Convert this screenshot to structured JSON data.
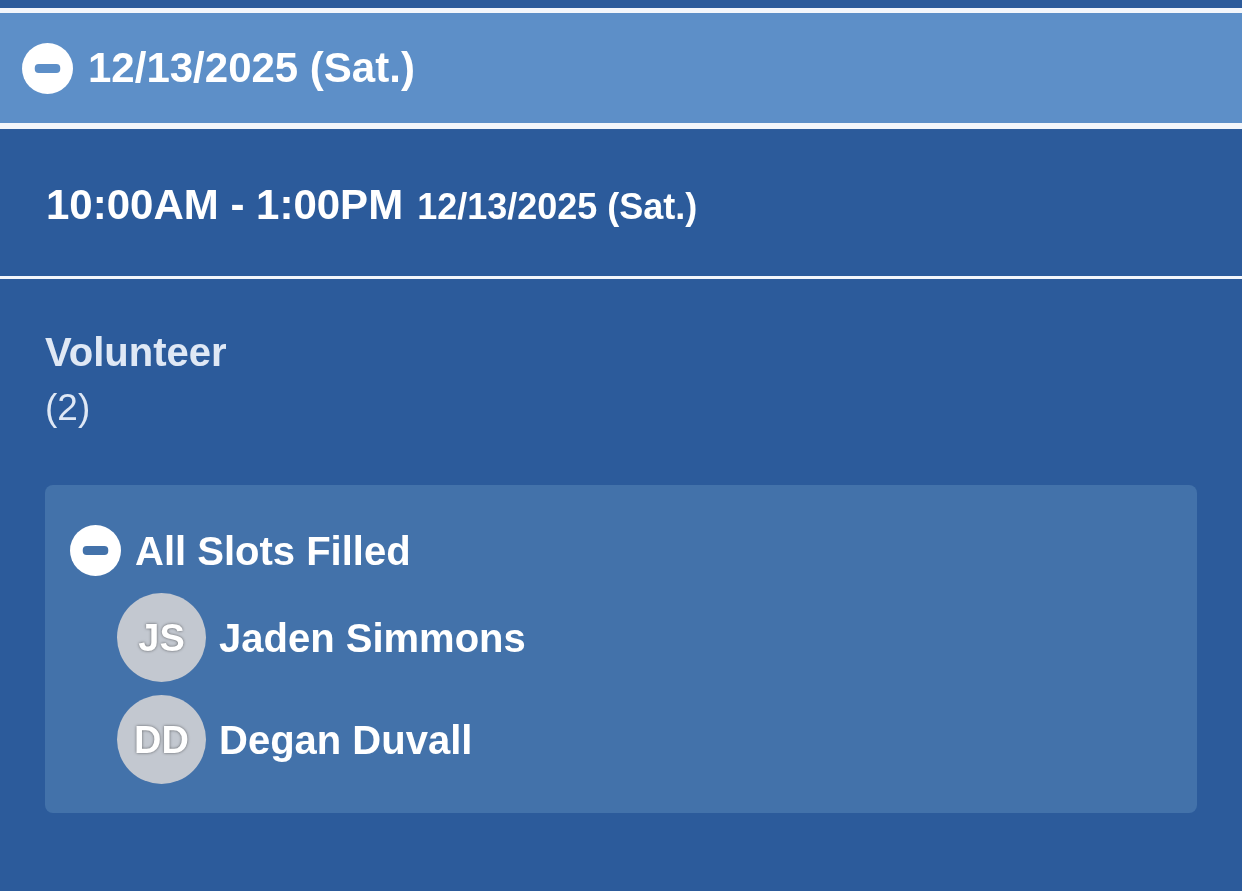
{
  "date_header": {
    "label": "12/13/2025 (Sat.)",
    "expanded": true
  },
  "shift": {
    "time": "10:00AM - 1:00PM",
    "date": "12/13/2025 (Sat.)"
  },
  "role": {
    "name": "Volunteer",
    "count": "(2)"
  },
  "slots": {
    "label": "All Slots Filled",
    "expanded": true,
    "people": [
      {
        "initials": "JS",
        "name": "Jaden Simmons"
      },
      {
        "initials": "DD",
        "name": "Degan Duvall"
      }
    ]
  }
}
